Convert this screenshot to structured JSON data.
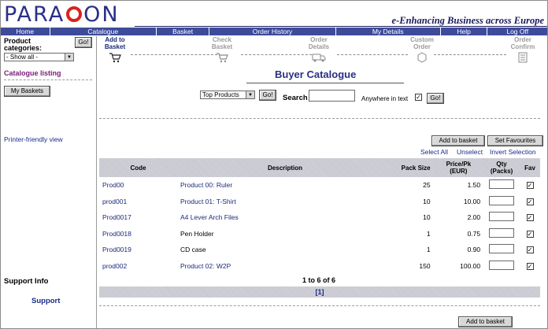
{
  "brand": {
    "logo_text_left": "PARA",
    "logo_text_right": "ON",
    "tagline": "e-Enhancing Business across Europe"
  },
  "nav": [
    "Home",
    "Catalogue",
    "Basket",
    "Order History",
    "My Details",
    "Help",
    "Log Off"
  ],
  "sidebar": {
    "categories_label": "Product categories:",
    "go_label": "Go!",
    "category_selected": "- Show all -",
    "catalogue_listing": "Catalogue listing",
    "my_baskets": "My Baskets",
    "printer_friendly": "Printer-friendly view",
    "support_info": "Support Info",
    "support": "Support"
  },
  "steps": [
    {
      "label": "Add to Basket",
      "active": true
    },
    {
      "label": "Check Basket",
      "active": false
    },
    {
      "label": "Order Details",
      "active": false
    },
    {
      "label": "Custom Order",
      "active": false
    },
    {
      "label": "Order Confirm",
      "active": false
    }
  ],
  "main": {
    "title": "Buyer Catalogue",
    "filter_selected": "Top Products",
    "go_label": "Go!",
    "search_label": "Search",
    "anywhere_label": "Anywhere in text",
    "anywhere_checked": true,
    "add_to_basket": "Add to basket",
    "set_favourites": "Set Favourites",
    "select_all": "Select All",
    "unselect": "Unselect",
    "invert_selection": "Invert Selection",
    "columns": [
      "Code",
      "Description",
      "Pack Size",
      "Price/Pk (EUR)",
      "Qty (Packs)",
      "Fav"
    ],
    "rows": [
      {
        "code": "Prod00",
        "desc": "Product 00: Ruler",
        "pack": "25",
        "price": "1.50",
        "fav": true
      },
      {
        "code": "prod001",
        "desc": "Product 01: T-Shirt",
        "pack": "10",
        "price": "10.00",
        "fav": true
      },
      {
        "code": "Prod0017",
        "desc": "A4 Lever Arch Files",
        "pack": "10",
        "price": "2.00",
        "fav": true
      },
      {
        "code": "Prod0018",
        "desc": "Pen Holder",
        "pack": "1",
        "price": "0.75",
        "fav": true
      },
      {
        "code": "Prod0019",
        "desc": "CD case",
        "pack": "1",
        "price": "0.90",
        "fav": true
      },
      {
        "code": "prod002",
        "desc": "Product 02: W2P",
        "pack": "150",
        "price": "100.00",
        "fav": true
      }
    ],
    "count_text": "1 to 6 of 6",
    "pager": "[1]",
    "add_to_basket_bottom": "Add to basket"
  }
}
